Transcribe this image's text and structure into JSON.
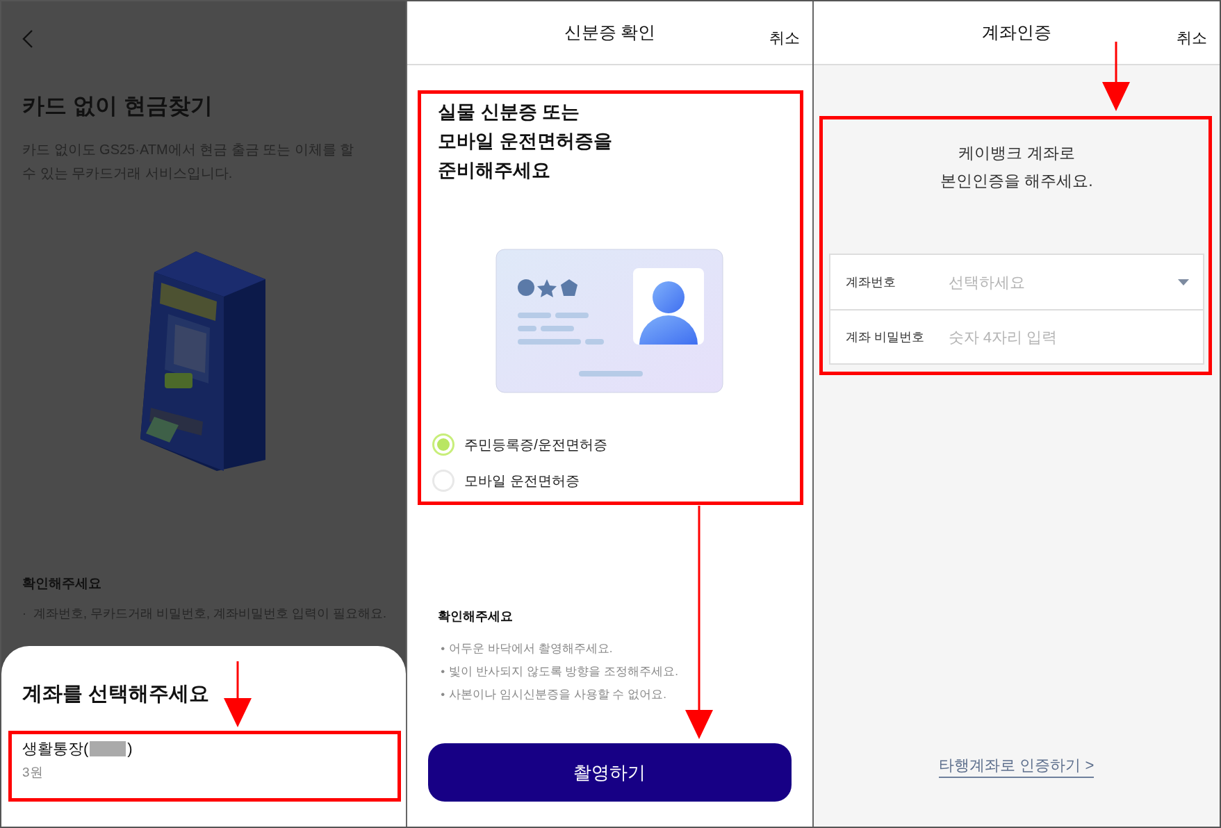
{
  "cardless_screen": {
    "title": "카드 없이 현금찾기",
    "description": "카드 없이도 GS25·ATM에서 현금 출금 또는 이체를 할 수 있는 무카드거래 서비스입니다.",
    "notice_title": "확인해주세요",
    "bullet": "·",
    "notices": [
      "계좌번호, 무카드거래 비밀번호, 계좌비밀번호 입력이 필요해요."
    ],
    "sheet": {
      "title": "계좌를 선택해주세요",
      "accounts": [
        {
          "name_open": "생활통장(",
          "name_close": ")",
          "balance": "3원"
        }
      ]
    }
  },
  "id_check_screen": {
    "title": "신분증 확인",
    "cancel": "취소",
    "heading_lines": [
      "실물 신분증 또는",
      "모바일 운전면허증을",
      "준비해주세요"
    ],
    "options": [
      {
        "label": "주민등록증/운전면허증",
        "selected": true
      },
      {
        "label": "모바일 운전면허증",
        "selected": false
      }
    ],
    "notice_title": "확인해주세요",
    "bullet": "•",
    "notices": [
      "어두운 바닥에서 촬영해주세요.",
      "빛이 반사되지 않도록 방향을 조정해주세요.",
      "사본이나 임시신분증을 사용할 수 없어요."
    ],
    "button": "촬영하기"
  },
  "account_auth_screen": {
    "title": "계좌인증",
    "cancel": "취소",
    "message_lines": [
      "케이뱅크 계좌로",
      "본인인증을 해주세요."
    ],
    "fields": [
      {
        "kind": "select",
        "label": "계좌번호",
        "placeholder": "선택하세요"
      },
      {
        "kind": "input",
        "label": "계좌 비밀번호",
        "placeholder": "숫자 4자리 입력"
      }
    ],
    "link": "타행계좌로 인증하기 >"
  }
}
